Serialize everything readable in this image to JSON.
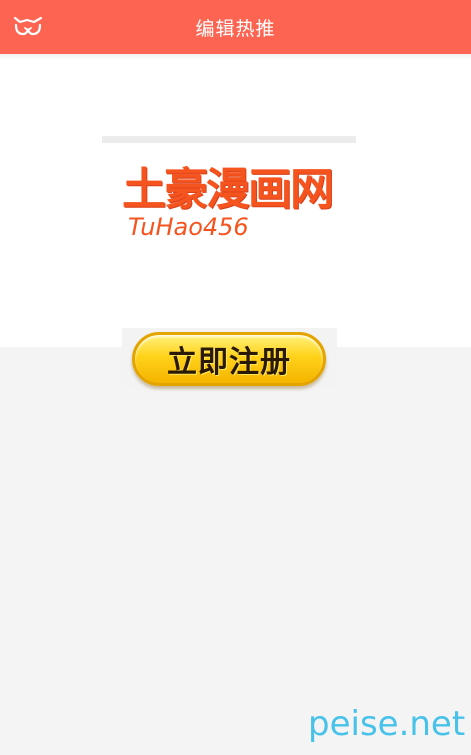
{
  "header": {
    "title": "编辑热推",
    "logo_icon": "cat-face-icon",
    "background_color": "#fd6452"
  },
  "brand": {
    "title": "土豪漫画网",
    "subtitle": "TuHao456",
    "color": "#f6541f"
  },
  "register": {
    "label": "立即注册",
    "color": "#ffd21a"
  },
  "watermark": {
    "text": "peise.net",
    "color": "#3fc0e8"
  }
}
